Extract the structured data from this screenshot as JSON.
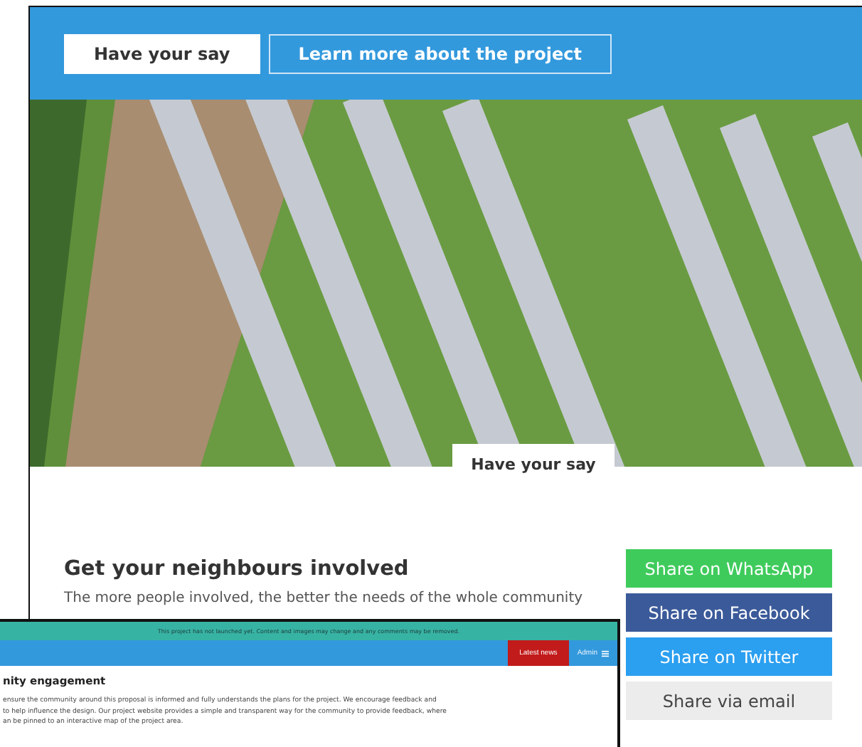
{
  "header": {
    "buttons": [
      {
        "label": "Have your say",
        "selected": true
      },
      {
        "label": "Learn more about the project",
        "selected": false
      }
    ]
  },
  "hero": {
    "kind": "picture",
    "tab": "Have your say"
  },
  "involve": {
    "title": "Get your neighbours involved",
    "text": "The more people involved, the better the needs of the whole community"
  },
  "share": [
    {
      "label": "Share on WhatsApp",
      "color": "#3fcb5c"
    },
    {
      "label": "Share on Facebook",
      "color": "#3b5a9a"
    },
    {
      "label": "Share on Twitter",
      "color": "#2b9ff0"
    },
    {
      "label": "Share via email",
      "color": "#ececec"
    }
  ],
  "overlay": {
    "notice": "This project has not launched yet. Content and images may change and any comments may be removed.",
    "nav": [
      {
        "label": "Latest news",
        "kind": "highlight"
      },
      {
        "label": "Admin",
        "kind": "menu"
      }
    ],
    "title": "nity engagement",
    "lines": [
      "ensure the community around this proposal is informed and fully understands the plans for the project. We encourage feedback and",
      "to help influence the design. Our project website provides a simple and transparent way for the community to provide feedback, where",
      "an be pinned to an interactive map of the project area."
    ]
  }
}
